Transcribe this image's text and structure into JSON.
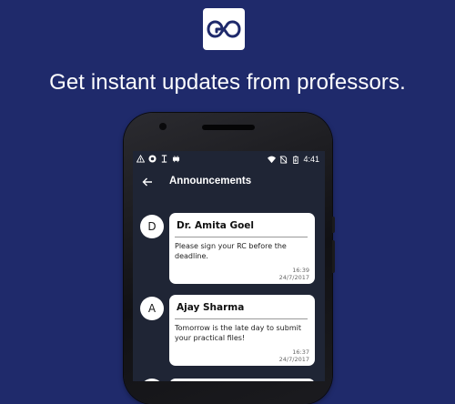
{
  "brand": {
    "logo_icon": "go-infinity-logo-icon",
    "colors": {
      "background": "#1f2a6b",
      "logo": "#1f2a6b",
      "screen": "#1f2535",
      "card": "#ffffff"
    }
  },
  "tagline": "Get instant updates from professors.",
  "statusbar": {
    "left_icons": [
      "warning-icon",
      "record-icon",
      "signal-icon",
      "android-icon"
    ],
    "right_icons": [
      "wifi-icon",
      "no-sim-icon",
      "battery-icon"
    ],
    "time": "4:41"
  },
  "appbar": {
    "back_icon": "back-arrow-icon",
    "title": "Announcements"
  },
  "announcements": [
    {
      "initial": "D",
      "name": "Dr. Amita Goel",
      "message": "Please sign your RC before the deadline.",
      "time": "16:39",
      "date": "24/7/2017"
    },
    {
      "initial": "A",
      "name": "Ajay Sharma",
      "message": "Tomorrow is the late day to submit your practical files!",
      "time": "16:37",
      "date": "24/7/2017"
    }
  ]
}
